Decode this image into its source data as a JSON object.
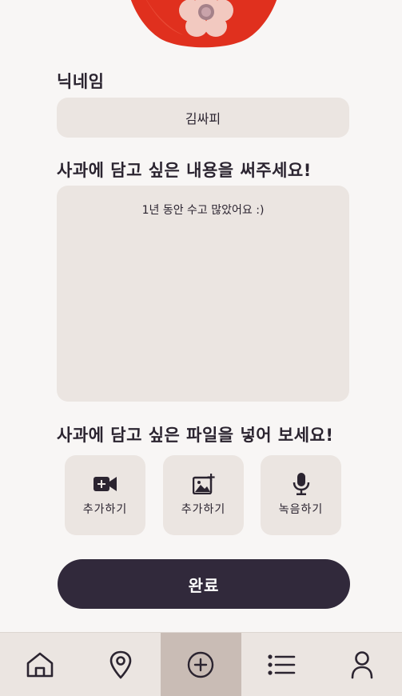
{
  "form": {
    "nickname_label": "닉네임",
    "nickname_value": "김싸피",
    "content_label": "사과에 담고 싶은 내용을 써주세요!",
    "content_value": "1년 동안 수고 많았어요 :)",
    "file_label": "사과에 담고 싶은 파일을 넣어 보세요!"
  },
  "media_buttons": [
    {
      "label": "추가하기",
      "icon": "video-add-icon"
    },
    {
      "label": "추가하기",
      "icon": "image-add-icon"
    },
    {
      "label": "녹음하기",
      "icon": "microphone-icon"
    }
  ],
  "done_label": "완료",
  "nav": {
    "items": [
      {
        "icon": "home-icon",
        "active": false
      },
      {
        "icon": "location-pin-icon",
        "active": false
      },
      {
        "icon": "plus-circle-icon",
        "active": true
      },
      {
        "icon": "list-icon",
        "active": false
      },
      {
        "icon": "user-icon",
        "active": false
      }
    ]
  },
  "colors": {
    "background": "#f8f6f5",
    "field": "#ebe5e1",
    "primary_button": "#31293b",
    "nav_active": "#c9bcb5",
    "apple_red": "#e0301e",
    "flower_pink": "#f2c9c0"
  }
}
